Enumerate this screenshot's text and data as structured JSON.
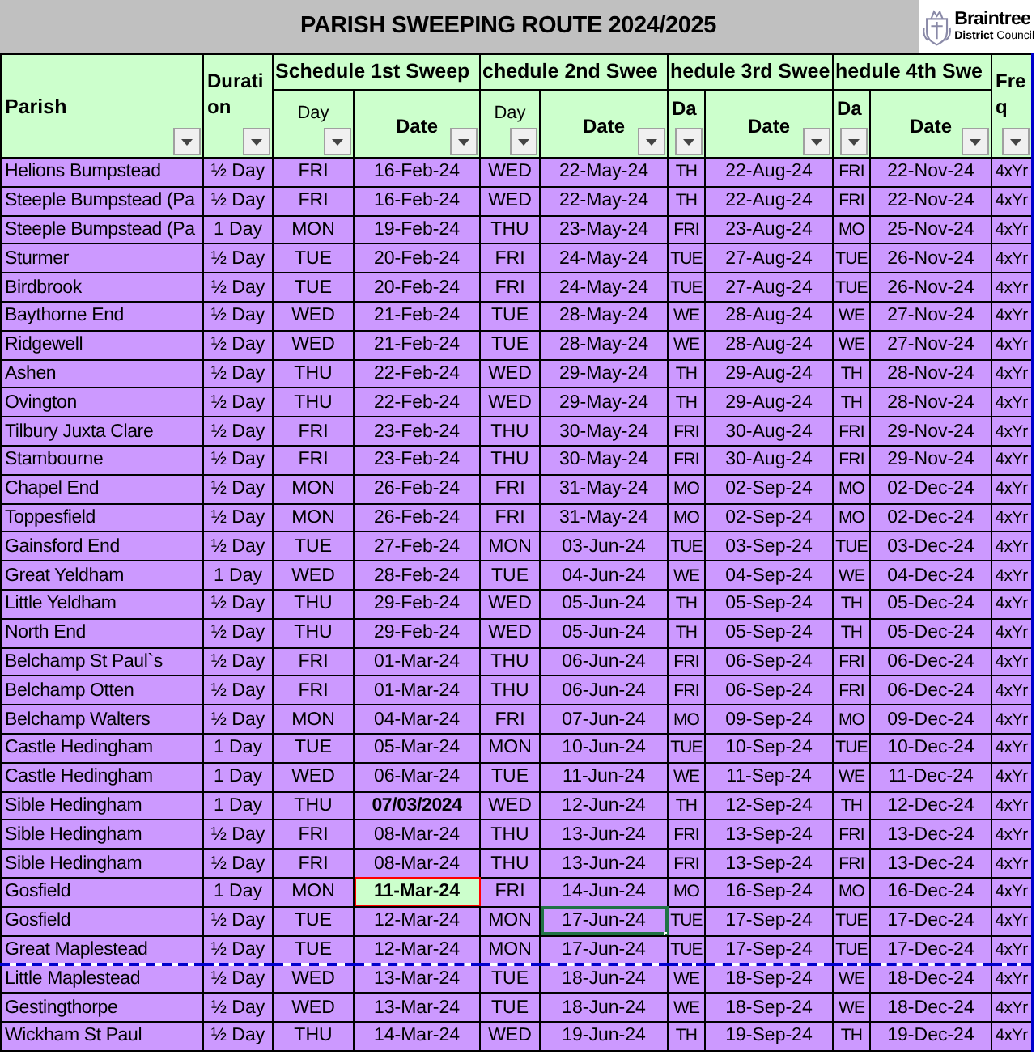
{
  "title": "PARISH SWEEPING ROUTE 2024/2025",
  "logo": {
    "name": "Braintree",
    "subtitle_bold": "District",
    "subtitle": "Council"
  },
  "columns": {
    "parish": "Parish",
    "duration": "Duration",
    "freq": "Freq",
    "sweeps": [
      {
        "heading": "Schedule 1st Sweep",
        "day": "Day",
        "date": "Date"
      },
      {
        "heading": "chedule 2nd Swee",
        "day": "Day",
        "date": "Date"
      },
      {
        "heading": "hedule 3rd Swee",
        "day": "Da",
        "date": "Date"
      },
      {
        "heading": "hedule 4th Swe",
        "day": "Da",
        "date": "Date"
      }
    ]
  },
  "rows": [
    {
      "parish": "Helions Bumpstead",
      "duration": "½ Day",
      "freq": "4xYr",
      "page_break": false,
      "sweeps": [
        {
          "day": "FRI",
          "date": "16-Feb-24",
          "kind": "plain",
          "selected": false
        },
        {
          "day": "WED",
          "date": "22-May-24",
          "kind": "plain",
          "selected": false
        },
        {
          "day": "TH",
          "date": "22-Aug-24",
          "kind": "plain",
          "selected": false
        },
        {
          "day": "FRI",
          "date": "22-Nov-24",
          "kind": "plain",
          "selected": false
        }
      ]
    },
    {
      "parish": "Steeple Bumpstead (Pa",
      "duration": "½ Day",
      "freq": "4xYr",
      "page_break": false,
      "sweeps": [
        {
          "day": "FRI",
          "date": "16-Feb-24",
          "kind": "plain",
          "selected": false
        },
        {
          "day": "WED",
          "date": "22-May-24",
          "kind": "plain",
          "selected": false
        },
        {
          "day": "TH",
          "date": "22-Aug-24",
          "kind": "plain",
          "selected": false
        },
        {
          "day": "FRI",
          "date": "22-Nov-24",
          "kind": "plain",
          "selected": false
        }
      ]
    },
    {
      "parish": "Steeple Bumpstead (Pa",
      "duration": "1 Day",
      "freq": "4xYr",
      "page_break": false,
      "sweeps": [
        {
          "day": "MON",
          "date": "19-Feb-24",
          "kind": "plain",
          "selected": false
        },
        {
          "day": "THU",
          "date": "23-May-24",
          "kind": "plain",
          "selected": false
        },
        {
          "day": "FRI",
          "date": "23-Aug-24",
          "kind": "plain",
          "selected": false
        },
        {
          "day": "MO",
          "date": "25-Nov-24",
          "kind": "plain",
          "selected": false
        }
      ]
    },
    {
      "parish": "Sturmer",
      "duration": "½ Day",
      "freq": "4xYr",
      "page_break": false,
      "sweeps": [
        {
          "day": "TUE",
          "date": "20-Feb-24",
          "kind": "plain",
          "selected": false
        },
        {
          "day": "FRI",
          "date": "24-May-24",
          "kind": "plain",
          "selected": false
        },
        {
          "day": "TUE",
          "date": "27-Aug-24",
          "kind": "plain",
          "selected": false
        },
        {
          "day": "TUE",
          "date": "26-Nov-24",
          "kind": "plain",
          "selected": false
        }
      ]
    },
    {
      "parish": "Birdbrook",
      "duration": "½ Day",
      "freq": "4xYr",
      "page_break": false,
      "sweeps": [
        {
          "day": "TUE",
          "date": "20-Feb-24",
          "kind": "plain",
          "selected": false
        },
        {
          "day": "FRI",
          "date": "24-May-24",
          "kind": "plain",
          "selected": false
        },
        {
          "day": "TUE",
          "date": "27-Aug-24",
          "kind": "plain",
          "selected": false
        },
        {
          "day": "TUE",
          "date": "26-Nov-24",
          "kind": "plain",
          "selected": false
        }
      ]
    },
    {
      "parish": "Baythorne End",
      "duration": "½ Day",
      "freq": "4xYr",
      "page_break": false,
      "sweeps": [
        {
          "day": "WED",
          "date": "21-Feb-24",
          "kind": "plain",
          "selected": false
        },
        {
          "day": "TUE",
          "date": "28-May-24",
          "kind": "plain",
          "selected": false
        },
        {
          "day": "WE",
          "date": "28-Aug-24",
          "kind": "plain",
          "selected": false
        },
        {
          "day": "WE",
          "date": "27-Nov-24",
          "kind": "plain",
          "selected": false
        }
      ]
    },
    {
      "parish": "Ridgewell",
      "duration": "½ Day",
      "freq": "4xYr",
      "page_break": false,
      "sweeps": [
        {
          "day": "WED",
          "date": "21-Feb-24",
          "kind": "plain",
          "selected": false
        },
        {
          "day": "TUE",
          "date": "28-May-24",
          "kind": "plain",
          "selected": false
        },
        {
          "day": "WE",
          "date": "28-Aug-24",
          "kind": "plain",
          "selected": false
        },
        {
          "day": "WE",
          "date": "27-Nov-24",
          "kind": "plain",
          "selected": false
        }
      ]
    },
    {
      "parish": "Ashen",
      "duration": "½ Day",
      "freq": "4xYr",
      "page_break": false,
      "sweeps": [
        {
          "day": "THU",
          "date": "22-Feb-24",
          "kind": "plain",
          "selected": false
        },
        {
          "day": "WED",
          "date": "29-May-24",
          "kind": "plain",
          "selected": false
        },
        {
          "day": "TH",
          "date": "29-Aug-24",
          "kind": "plain",
          "selected": false
        },
        {
          "day": "TH",
          "date": "28-Nov-24",
          "kind": "plain",
          "selected": false
        }
      ]
    },
    {
      "parish": "Ovington",
      "duration": "½ Day",
      "freq": "4xYr",
      "page_break": false,
      "sweeps": [
        {
          "day": "THU",
          "date": "22-Feb-24",
          "kind": "plain",
          "selected": false
        },
        {
          "day": "WED",
          "date": "29-May-24",
          "kind": "plain",
          "selected": false
        },
        {
          "day": "TH",
          "date": "29-Aug-24",
          "kind": "plain",
          "selected": false
        },
        {
          "day": "TH",
          "date": "28-Nov-24",
          "kind": "plain",
          "selected": false
        }
      ]
    },
    {
      "parish": "Tilbury Juxta Clare",
      "duration": "½ Day",
      "freq": "4xYr",
      "page_break": false,
      "sweeps": [
        {
          "day": "FRI",
          "date": "23-Feb-24",
          "kind": "plain",
          "selected": false
        },
        {
          "day": "THU",
          "date": "30-May-24",
          "kind": "plain",
          "selected": false
        },
        {
          "day": "FRI",
          "date": "30-Aug-24",
          "kind": "plain",
          "selected": false
        },
        {
          "day": "FRI",
          "date": "29-Nov-24",
          "kind": "plain",
          "selected": false
        }
      ]
    },
    {
      "parish": "Stambourne",
      "duration": "½ Day",
      "freq": "4xYr",
      "page_break": false,
      "sweeps": [
        {
          "day": "FRI",
          "date": "23-Feb-24",
          "kind": "plain",
          "selected": false
        },
        {
          "day": "THU",
          "date": "30-May-24",
          "kind": "plain",
          "selected": false
        },
        {
          "day": "FRI",
          "date": "30-Aug-24",
          "kind": "plain",
          "selected": false
        },
        {
          "day": "FRI",
          "date": "29-Nov-24",
          "kind": "plain",
          "selected": false
        }
      ]
    },
    {
      "parish": "Chapel End",
      "duration": "½ Day",
      "freq": "4xYr",
      "page_break": false,
      "sweeps": [
        {
          "day": "MON",
          "date": "26-Feb-24",
          "kind": "plain",
          "selected": false
        },
        {
          "day": "FRI",
          "date": "31-May-24",
          "kind": "plain",
          "selected": false
        },
        {
          "day": "MO",
          "date": "02-Sep-24",
          "kind": "plain",
          "selected": false
        },
        {
          "day": "MO",
          "date": "02-Dec-24",
          "kind": "plain",
          "selected": false
        }
      ]
    },
    {
      "parish": "Toppesfield",
      "duration": "½ Day",
      "freq": "4xYr",
      "page_break": false,
      "sweeps": [
        {
          "day": "MON",
          "date": "26-Feb-24",
          "kind": "plain",
          "selected": false
        },
        {
          "day": "FRI",
          "date": "31-May-24",
          "kind": "plain",
          "selected": false
        },
        {
          "day": "MO",
          "date": "02-Sep-24",
          "kind": "plain",
          "selected": false
        },
        {
          "day": "MO",
          "date": "02-Dec-24",
          "kind": "plain",
          "selected": false
        }
      ]
    },
    {
      "parish": "Gainsford End",
      "duration": "½ Day",
      "freq": "4xYr",
      "page_break": false,
      "sweeps": [
        {
          "day": "TUE",
          "date": "27-Feb-24",
          "kind": "plain",
          "selected": false
        },
        {
          "day": "MON",
          "date": "03-Jun-24",
          "kind": "plain",
          "selected": false
        },
        {
          "day": "TUE",
          "date": "03-Sep-24",
          "kind": "plain",
          "selected": false
        },
        {
          "day": "TUE",
          "date": "03-Dec-24",
          "kind": "plain",
          "selected": false
        }
      ]
    },
    {
      "parish": "Great Yeldham",
      "duration": "1 Day",
      "freq": "4xYr",
      "page_break": false,
      "sweeps": [
        {
          "day": "WED",
          "date": "28-Feb-24",
          "kind": "plain",
          "selected": false
        },
        {
          "day": "TUE",
          "date": "04-Jun-24",
          "kind": "plain",
          "selected": false
        },
        {
          "day": "WE",
          "date": "04-Sep-24",
          "kind": "plain",
          "selected": false
        },
        {
          "day": "WE",
          "date": "04-Dec-24",
          "kind": "plain",
          "selected": false
        }
      ]
    },
    {
      "parish": "Little Yeldham",
      "duration": "½ Day",
      "freq": "4xYr",
      "page_break": false,
      "sweeps": [
        {
          "day": "THU",
          "date": "29-Feb-24",
          "kind": "plain",
          "selected": false
        },
        {
          "day": "WED",
          "date": "05-Jun-24",
          "kind": "plain",
          "selected": false
        },
        {
          "day": "TH",
          "date": "05-Sep-24",
          "kind": "plain",
          "selected": false
        },
        {
          "day": "TH",
          "date": "05-Dec-24",
          "kind": "plain",
          "selected": false
        }
      ]
    },
    {
      "parish": "North End",
      "duration": "½ Day",
      "freq": "4xYr",
      "page_break": false,
      "sweeps": [
        {
          "day": "THU",
          "date": "29-Feb-24",
          "kind": "plain",
          "selected": false
        },
        {
          "day": "WED",
          "date": "05-Jun-24",
          "kind": "plain",
          "selected": false
        },
        {
          "day": "TH",
          "date": "05-Sep-24",
          "kind": "plain",
          "selected": false
        },
        {
          "day": "TH",
          "date": "05-Dec-24",
          "kind": "plain",
          "selected": false
        }
      ]
    },
    {
      "parish": "Belchamp St Paul`s",
      "duration": "½ Day",
      "freq": "4xYr",
      "page_break": false,
      "sweeps": [
        {
          "day": "FRI",
          "date": "01-Mar-24",
          "kind": "plain",
          "selected": false
        },
        {
          "day": "THU",
          "date": "06-Jun-24",
          "kind": "plain",
          "selected": false
        },
        {
          "day": "FRI",
          "date": "06-Sep-24",
          "kind": "plain",
          "selected": false
        },
        {
          "day": "FRI",
          "date": "06-Dec-24",
          "kind": "plain",
          "selected": false
        }
      ]
    },
    {
      "parish": "Belchamp Otten",
      "duration": "½ Day",
      "freq": "4xYr",
      "page_break": false,
      "sweeps": [
        {
          "day": "FRI",
          "date": "01-Mar-24",
          "kind": "plain",
          "selected": false
        },
        {
          "day": "THU",
          "date": "06-Jun-24",
          "kind": "plain",
          "selected": false
        },
        {
          "day": "FRI",
          "date": "06-Sep-24",
          "kind": "plain",
          "selected": false
        },
        {
          "day": "FRI",
          "date": "06-Dec-24",
          "kind": "plain",
          "selected": false
        }
      ]
    },
    {
      "parish": "Belchamp Walters",
      "duration": "½ Day",
      "freq": "4xYr",
      "page_break": false,
      "sweeps": [
        {
          "day": "MON",
          "date": "04-Mar-24",
          "kind": "plain",
          "selected": false
        },
        {
          "day": "FRI",
          "date": "07-Jun-24",
          "kind": "plain",
          "selected": false
        },
        {
          "day": "MO",
          "date": "09-Sep-24",
          "kind": "plain",
          "selected": false
        },
        {
          "day": "MO",
          "date": "09-Dec-24",
          "kind": "plain",
          "selected": false
        }
      ]
    },
    {
      "parish": "Castle Hedingham",
      "duration": "1 Day",
      "freq": "4xYr",
      "page_break": false,
      "sweeps": [
        {
          "day": "TUE",
          "date": "05-Mar-24",
          "kind": "plain",
          "selected": false
        },
        {
          "day": "MON",
          "date": "10-Jun-24",
          "kind": "plain",
          "selected": false
        },
        {
          "day": "TUE",
          "date": "10-Sep-24",
          "kind": "plain",
          "selected": false
        },
        {
          "day": "TUE",
          "date": "10-Dec-24",
          "kind": "plain",
          "selected": false
        }
      ]
    },
    {
      "parish": "Castle Hedingham",
      "duration": "1 Day",
      "freq": "4xYr",
      "page_break": false,
      "sweeps": [
        {
          "day": "WED",
          "date": "06-Mar-24",
          "kind": "plain",
          "selected": false
        },
        {
          "day": "TUE",
          "date": "11-Jun-24",
          "kind": "plain",
          "selected": false
        },
        {
          "day": "WE",
          "date": "11-Sep-24",
          "kind": "plain",
          "selected": false
        },
        {
          "day": "WE",
          "date": "11-Dec-24",
          "kind": "plain",
          "selected": false
        }
      ]
    },
    {
      "parish": "Sible Hedingham",
      "duration": "1 Day",
      "freq": "4xYr",
      "page_break": false,
      "sweeps": [
        {
          "day": "THU",
          "date": "07/03/2024",
          "kind": "bold",
          "selected": false
        },
        {
          "day": "WED",
          "date": "12-Jun-24",
          "kind": "plain",
          "selected": false
        },
        {
          "day": "TH",
          "date": "12-Sep-24",
          "kind": "plain",
          "selected": false
        },
        {
          "day": "TH",
          "date": "12-Dec-24",
          "kind": "plain",
          "selected": false
        }
      ]
    },
    {
      "parish": "Sible Hedingham",
      "duration": "½ Day",
      "freq": "4xYr",
      "page_break": false,
      "sweeps": [
        {
          "day": "FRI",
          "date": "08-Mar-24",
          "kind": "plain",
          "selected": false
        },
        {
          "day": "THU",
          "date": "13-Jun-24",
          "kind": "plain",
          "selected": false
        },
        {
          "day": "FRI",
          "date": "13-Sep-24",
          "kind": "plain",
          "selected": false
        },
        {
          "day": "FRI",
          "date": "13-Dec-24",
          "kind": "plain",
          "selected": false
        }
      ]
    },
    {
      "parish": "Sible Hedingham",
      "duration": "½ Day",
      "freq": "4xYr",
      "page_break": false,
      "sweeps": [
        {
          "day": "FRI",
          "date": "08-Mar-24",
          "kind": "plain",
          "selected": false
        },
        {
          "day": "THU",
          "date": "13-Jun-24",
          "kind": "plain",
          "selected": false
        },
        {
          "day": "FRI",
          "date": "13-Sep-24",
          "kind": "plain",
          "selected": false
        },
        {
          "day": "FRI",
          "date": "13-Dec-24",
          "kind": "plain",
          "selected": false
        }
      ]
    },
    {
      "parish": "Gosfield",
      "duration": "1 Day",
      "freq": "4xYr",
      "page_break": false,
      "sweeps": [
        {
          "day": "MON",
          "date": "11-Mar-24",
          "kind": "flagged",
          "selected": false
        },
        {
          "day": "FRI",
          "date": "14-Jun-24",
          "kind": "plain",
          "selected": false
        },
        {
          "day": "MO",
          "date": "16-Sep-24",
          "kind": "plain",
          "selected": false
        },
        {
          "day": "MO",
          "date": "16-Dec-24",
          "kind": "plain",
          "selected": false
        }
      ]
    },
    {
      "parish": "Gosfield",
      "duration": "½ Day",
      "freq": "4xYr",
      "page_break": false,
      "sweeps": [
        {
          "day": "TUE",
          "date": "12-Mar-24",
          "kind": "plain",
          "selected": false
        },
        {
          "day": "MON",
          "date": "17-Jun-24",
          "kind": "plain",
          "selected": true
        },
        {
          "day": "TUE",
          "date": "17-Sep-24",
          "kind": "plain",
          "selected": false
        },
        {
          "day": "TUE",
          "date": "17-Dec-24",
          "kind": "plain",
          "selected": false
        }
      ]
    },
    {
      "parish": "Great Maplestead",
      "duration": "½ Day",
      "freq": "4xYr",
      "page_break": true,
      "sweeps": [
        {
          "day": "TUE",
          "date": "12-Mar-24",
          "kind": "plain",
          "selected": false
        },
        {
          "day": "MON",
          "date": "17-Jun-24",
          "kind": "plain",
          "selected": false
        },
        {
          "day": "TUE",
          "date": "17-Sep-24",
          "kind": "plain",
          "selected": false
        },
        {
          "day": "TUE",
          "date": "17-Dec-24",
          "kind": "plain",
          "selected": false
        }
      ]
    },
    {
      "parish": "Little Maplestead",
      "duration": "½ Day",
      "freq": "4xYr",
      "page_break": false,
      "sweeps": [
        {
          "day": "WED",
          "date": "13-Mar-24",
          "kind": "plain",
          "selected": false
        },
        {
          "day": "TUE",
          "date": "18-Jun-24",
          "kind": "plain",
          "selected": false
        },
        {
          "day": "WE",
          "date": "18-Sep-24",
          "kind": "plain",
          "selected": false
        },
        {
          "day": "WE",
          "date": "18-Dec-24",
          "kind": "plain",
          "selected": false
        }
      ]
    },
    {
      "parish": "Gestingthorpe",
      "duration": "½ Day",
      "freq": "4xYr",
      "page_break": false,
      "sweeps": [
        {
          "day": "WED",
          "date": "13-Mar-24",
          "kind": "plain",
          "selected": false
        },
        {
          "day": "TUE",
          "date": "18-Jun-24",
          "kind": "plain",
          "selected": false
        },
        {
          "day": "WE",
          "date": "18-Sep-24",
          "kind": "plain",
          "selected": false
        },
        {
          "day": "WE",
          "date": "18-Dec-24",
          "kind": "plain",
          "selected": false
        }
      ]
    },
    {
      "parish": "Wickham St Paul",
      "duration": "½ Day",
      "freq": "4xYr",
      "page_break": false,
      "sweeps": [
        {
          "day": "THU",
          "date": "14-Mar-24",
          "kind": "plain",
          "selected": false
        },
        {
          "day": "WED",
          "date": "19-Jun-24",
          "kind": "plain",
          "selected": false
        },
        {
          "day": "TH",
          "date": "19-Sep-24",
          "kind": "plain",
          "selected": false
        },
        {
          "day": "TH",
          "date": "19-Dec-24",
          "kind": "plain",
          "selected": false
        }
      ]
    }
  ]
}
